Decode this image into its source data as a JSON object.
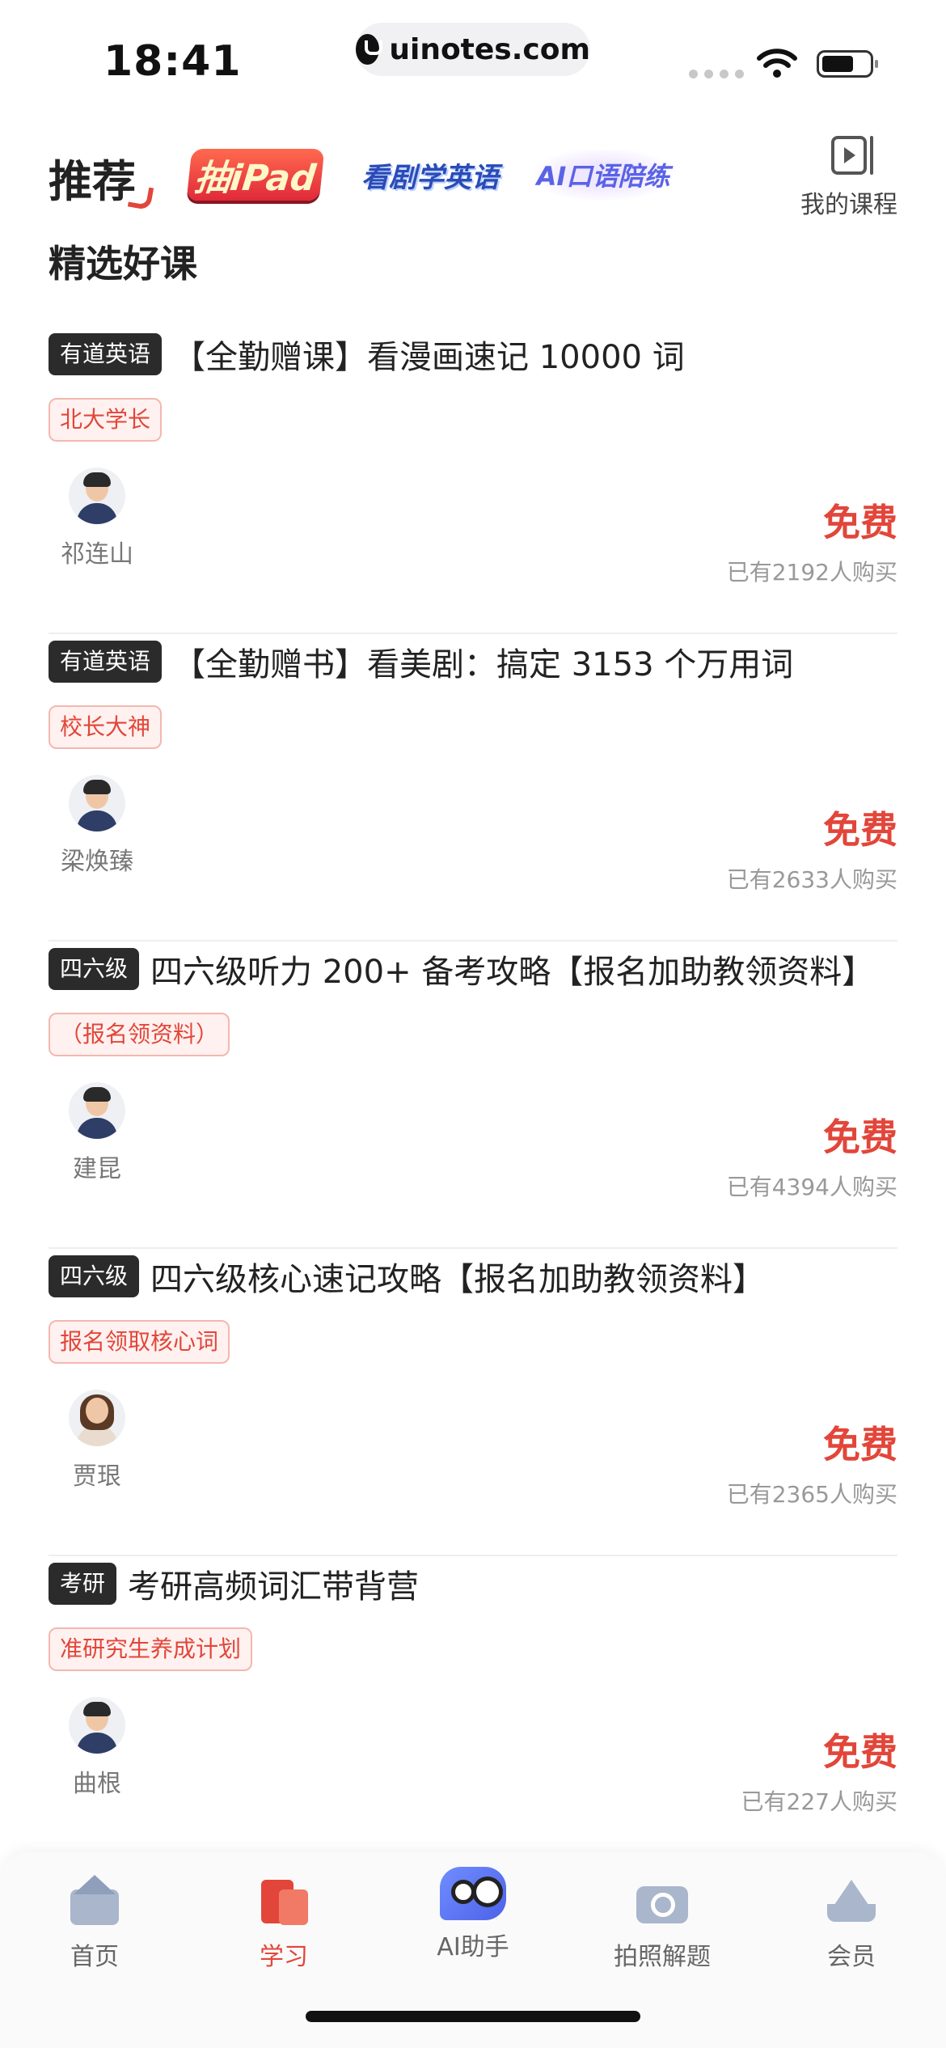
{
  "status_bar": {
    "time": "18:41",
    "url": "uinotes.com"
  },
  "nav": {
    "recommend": "推荐",
    "banners": [
      "抽iPad",
      "看剧学英语",
      "AI口语陪练"
    ],
    "my_courses": "我的课程"
  },
  "section_title": "精选好课",
  "courses": [
    {
      "category": "有道英语",
      "title": "【全勤赠课】看漫画速记 10000 词",
      "tag": "北大学长",
      "teacher": "祁连山",
      "price": "免费",
      "buyers": "已有2192人购买"
    },
    {
      "category": "有道英语",
      "title": "【全勤赠书】看美剧：搞定 3153 个万用词",
      "tag": "校长大神",
      "teacher": "梁焕臻",
      "price": "免费",
      "buyers": "已有2633人购买"
    },
    {
      "category": "四六级",
      "title": "四六级听力 200+ 备考攻略【报名加助教领资料】",
      "tag": "（报名领资料）",
      "teacher": "建昆",
      "price": "免费",
      "buyers": "已有4394人购买"
    },
    {
      "category": "四六级",
      "title": "四六级核心速记攻略【报名加助教领资料】",
      "tag": "报名领取核心词",
      "teacher": "贾珢",
      "price": "免费",
      "buyers": "已有2365人购买"
    },
    {
      "category": "考研",
      "title": "考研高频词汇带背营",
      "tag": "准研究生养成计划",
      "teacher": "曲根",
      "price": "免费",
      "buyers": "已有227人购买"
    }
  ],
  "tabs": [
    {
      "label": "首页",
      "icon": "home-icon"
    },
    {
      "label": "学习",
      "icon": "study-icon",
      "active": true
    },
    {
      "label": "AI助手",
      "icon": "ai-assistant-icon"
    },
    {
      "label": "拍照解题",
      "icon": "camera-icon"
    },
    {
      "label": "会员",
      "icon": "crown-icon"
    }
  ],
  "colors": {
    "accent": "#e2463a",
    "badge_bg": "#2b2b2b",
    "muted": "#999999"
  }
}
